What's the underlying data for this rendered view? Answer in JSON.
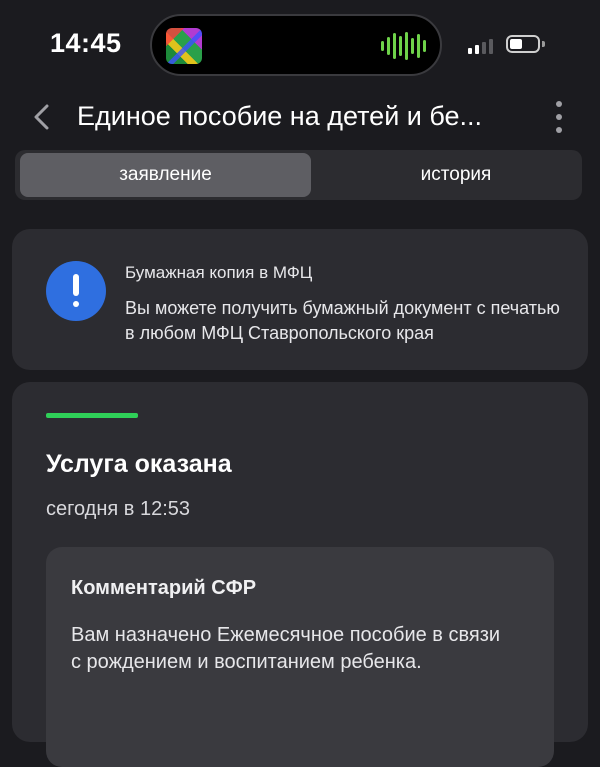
{
  "status_bar": {
    "time": "14:45"
  },
  "nav": {
    "title": "Единое пособие на детей и бе...",
    "back_icon": "chevron-left-icon",
    "more_icon": "vertical-ellipsis-icon"
  },
  "tabs": [
    {
      "label": "заявление",
      "active": true
    },
    {
      "label": "история",
      "active": false
    }
  ],
  "notice": {
    "icon": "exclamation-circle-icon",
    "title": "Бумажная копия в МФЦ",
    "text": "Вы можете получить бумажный документ с печатью в любом МФЦ Ставропольского края"
  },
  "status_card": {
    "title": "Услуга оказана",
    "time": "сегодня в 12:53",
    "comment_title": "Комментарий СФР",
    "comment_text": "Вам назначено Ежемесячное пособие в связи с рождением и воспитанием ребенка."
  },
  "colors": {
    "background": "#1b1b1f",
    "card": "#2c2c31",
    "accent_green": "#2fd058",
    "info_blue": "#2f6fe0"
  }
}
